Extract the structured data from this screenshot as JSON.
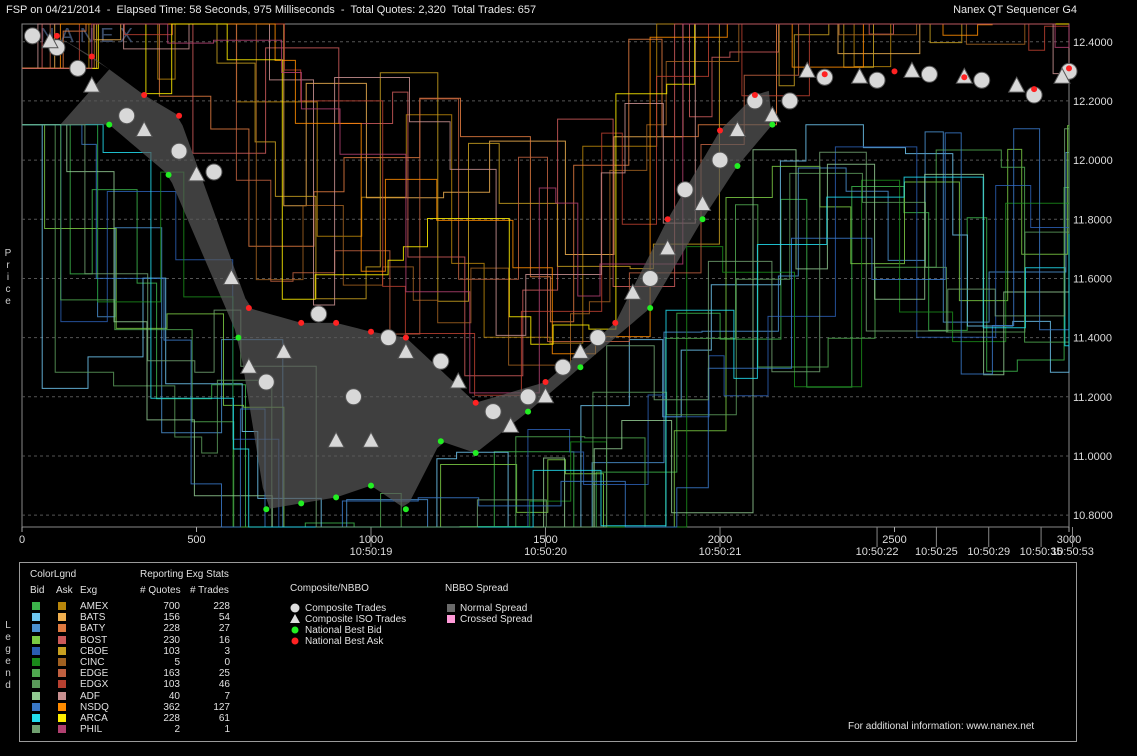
{
  "header": {
    "left": "FSP on 04/21/2014  -  Elapsed Time: 58 Seconds, 975 Milliseconds  -  Total Quotes: 2,320  Total Trades: 657",
    "right": "Nanex QT Sequencer G4"
  },
  "watermark": "NANEX",
  "price_label": "Price",
  "legend_label": "Legend",
  "chart_data": {
    "type": "scatter",
    "xlabel": "",
    "ylabel": "Price",
    "xlim": [
      0,
      3000
    ],
    "ylim": [
      10.76,
      12.46
    ],
    "x_ticks": [
      0,
      500,
      1000,
      1500,
      2000,
      2500,
      3000
    ],
    "x_tick_labels": [
      "0",
      "500",
      "1000",
      "1500",
      "2000",
      "2500",
      "3000"
    ],
    "y_ticks": [
      10.8,
      11.0,
      11.2,
      11.4,
      11.6,
      11.8,
      12.0,
      12.2,
      12.4
    ],
    "y_tick_labels": [
      "10.8000",
      "11.0000",
      "11.2000",
      "11.4000",
      "11.6000",
      "11.8000",
      "12.0000",
      "12.2000",
      "12.4000"
    ],
    "time_ticks": [
      {
        "x": 1000,
        "label": "10:50:19"
      },
      {
        "x": 1500,
        "label": "10:50:20"
      },
      {
        "x": 2000,
        "label": "10:50:21"
      },
      {
        "x": 2450,
        "label": "10:50:22"
      },
      {
        "x": 2620,
        "label": "10:50:25"
      },
      {
        "x": 2770,
        "label": "10:50:29"
      },
      {
        "x": 2920,
        "label": "10:50:35"
      },
      {
        "x": 3010,
        "label": "10:50:53"
      }
    ],
    "grid": true,
    "series": [
      {
        "name": "Composite Trades",
        "marker": "circle",
        "color": "#d8d8d8",
        "points": [
          [
            30,
            12.42
          ],
          [
            100,
            12.38
          ],
          [
            160,
            12.31
          ],
          [
            300,
            12.15
          ],
          [
            450,
            12.03
          ],
          [
            550,
            11.96
          ],
          [
            700,
            11.25
          ],
          [
            850,
            11.48
          ],
          [
            950,
            11.2
          ],
          [
            1050,
            11.4
          ],
          [
            1200,
            11.32
          ],
          [
            1350,
            11.15
          ],
          [
            1450,
            11.2
          ],
          [
            1550,
            11.3
          ],
          [
            1650,
            11.4
          ],
          [
            1800,
            11.6
          ],
          [
            1900,
            11.9
          ],
          [
            2000,
            12.0
          ],
          [
            2100,
            12.2
          ],
          [
            2200,
            12.2
          ],
          [
            2300,
            12.28
          ],
          [
            2450,
            12.27
          ],
          [
            2600,
            12.29
          ],
          [
            2750,
            12.27
          ],
          [
            2900,
            12.22
          ],
          [
            3000,
            12.3
          ]
        ]
      },
      {
        "name": "Composite ISO Trades",
        "marker": "triangle",
        "color": "#d8d8d8",
        "points": [
          [
            80,
            12.4
          ],
          [
            200,
            12.25
          ],
          [
            350,
            12.1
          ],
          [
            500,
            11.95
          ],
          [
            600,
            11.6
          ],
          [
            650,
            11.3
          ],
          [
            750,
            11.35
          ],
          [
            900,
            11.05
          ],
          [
            1000,
            11.05
          ],
          [
            1100,
            11.35
          ],
          [
            1250,
            11.25
          ],
          [
            1400,
            11.1
          ],
          [
            1500,
            11.2
          ],
          [
            1600,
            11.35
          ],
          [
            1750,
            11.55
          ],
          [
            1850,
            11.7
          ],
          [
            1950,
            11.85
          ],
          [
            2050,
            12.1
          ],
          [
            2150,
            12.15
          ],
          [
            2250,
            12.3
          ],
          [
            2400,
            12.28
          ],
          [
            2550,
            12.3
          ],
          [
            2700,
            12.28
          ],
          [
            2850,
            12.25
          ],
          [
            2980,
            12.28
          ]
        ]
      },
      {
        "name": "National Best Bid",
        "marker": "dot",
        "color": "#22ee22",
        "points": [
          [
            250,
            12.12
          ],
          [
            420,
            11.95
          ],
          [
            620,
            11.4
          ],
          [
            700,
            10.82
          ],
          [
            800,
            10.84
          ],
          [
            900,
            10.86
          ],
          [
            1000,
            10.9
          ],
          [
            1100,
            10.82
          ],
          [
            1200,
            11.05
          ],
          [
            1300,
            11.01
          ],
          [
            1450,
            11.15
          ],
          [
            1600,
            11.3
          ],
          [
            1800,
            11.5
          ],
          [
            1950,
            11.8
          ],
          [
            2050,
            11.98
          ],
          [
            2150,
            12.12
          ]
        ]
      },
      {
        "name": "National Best Ask",
        "marker": "dot",
        "color": "#ff2222",
        "points": [
          [
            100,
            12.42
          ],
          [
            200,
            12.35
          ],
          [
            350,
            12.22
          ],
          [
            450,
            12.15
          ],
          [
            650,
            11.5
          ],
          [
            800,
            11.45
          ],
          [
            900,
            11.45
          ],
          [
            1000,
            11.42
          ],
          [
            1100,
            11.4
          ],
          [
            1300,
            11.18
          ],
          [
            1500,
            11.25
          ],
          [
            1700,
            11.45
          ],
          [
            1850,
            11.8
          ],
          [
            2000,
            12.1
          ],
          [
            2100,
            12.22
          ],
          [
            2300,
            12.29
          ],
          [
            2500,
            12.3
          ],
          [
            2700,
            12.28
          ],
          [
            2900,
            12.24
          ],
          [
            3000,
            12.31
          ]
        ]
      }
    ]
  },
  "legend": {
    "title_color": "ColorLgnd",
    "col_bid": "Bid",
    "col_ask": "Ask",
    "col_exg": "Exg",
    "stats_title": "Reporting Exg Stats",
    "col_quotes": "# Quotes",
    "col_trades": "# Trades",
    "exchanges": [
      {
        "name": "AMEX",
        "quotes": "700",
        "trades": "228",
        "bid_color": "#3cb44b",
        "ask_color": "#b8860b"
      },
      {
        "name": "BATS",
        "quotes": "156",
        "trades": "54",
        "bid_color": "#6ec6f0",
        "ask_color": "#f0b050"
      },
      {
        "name": "BATY",
        "quotes": "228",
        "trades": "27",
        "bid_color": "#4a90d0",
        "ask_color": "#e07a40"
      },
      {
        "name": "BOST",
        "quotes": "230",
        "trades": "16",
        "bid_color": "#7ac943",
        "ask_color": "#cc5a5a"
      },
      {
        "name": "CBOE",
        "quotes": "103",
        "trades": "3",
        "bid_color": "#2a5db0",
        "ask_color": "#c8a020"
      },
      {
        "name": "CINC",
        "quotes": "5",
        "trades": "0",
        "bid_color": "#1a8a1a",
        "ask_color": "#a06020"
      },
      {
        "name": "EDGE",
        "quotes": "163",
        "trades": "25",
        "bid_color": "#50a850",
        "ask_color": "#c06040"
      },
      {
        "name": "EDGX",
        "quotes": "103",
        "trades": "46",
        "bid_color": "#5a9a5a",
        "ask_color": "#b84030"
      },
      {
        "name": "ADF",
        "quotes": "40",
        "trades": "7",
        "bid_color": "#90c890",
        "ask_color": "#c89090"
      },
      {
        "name": "NSDQ",
        "quotes": "362",
        "trades": "127",
        "bid_color": "#3a78c8",
        "ask_color": "#ff8c00"
      },
      {
        "name": "ARCA",
        "quotes": "228",
        "trades": "61",
        "bid_color": "#22ddee",
        "ask_color": "#ffee00"
      },
      {
        "name": "PHIL",
        "quotes": "2",
        "trades": "1",
        "bid_color": "#70a070",
        "ask_color": "#b04070"
      }
    ],
    "composite_title": "Composite/NBBO",
    "composite_items": [
      "Composite Trades",
      "Composite ISO Trades",
      "National Best Bid",
      "National Best Ask"
    ],
    "spread_title": "NBBO Spread",
    "spread_items": [
      {
        "label": "Normal Spread",
        "color": "#6a6a6a"
      },
      {
        "label": "Crossed Spread",
        "color": "#ff9ad8"
      }
    ],
    "footer": "For additional information: www.nanex.net"
  }
}
